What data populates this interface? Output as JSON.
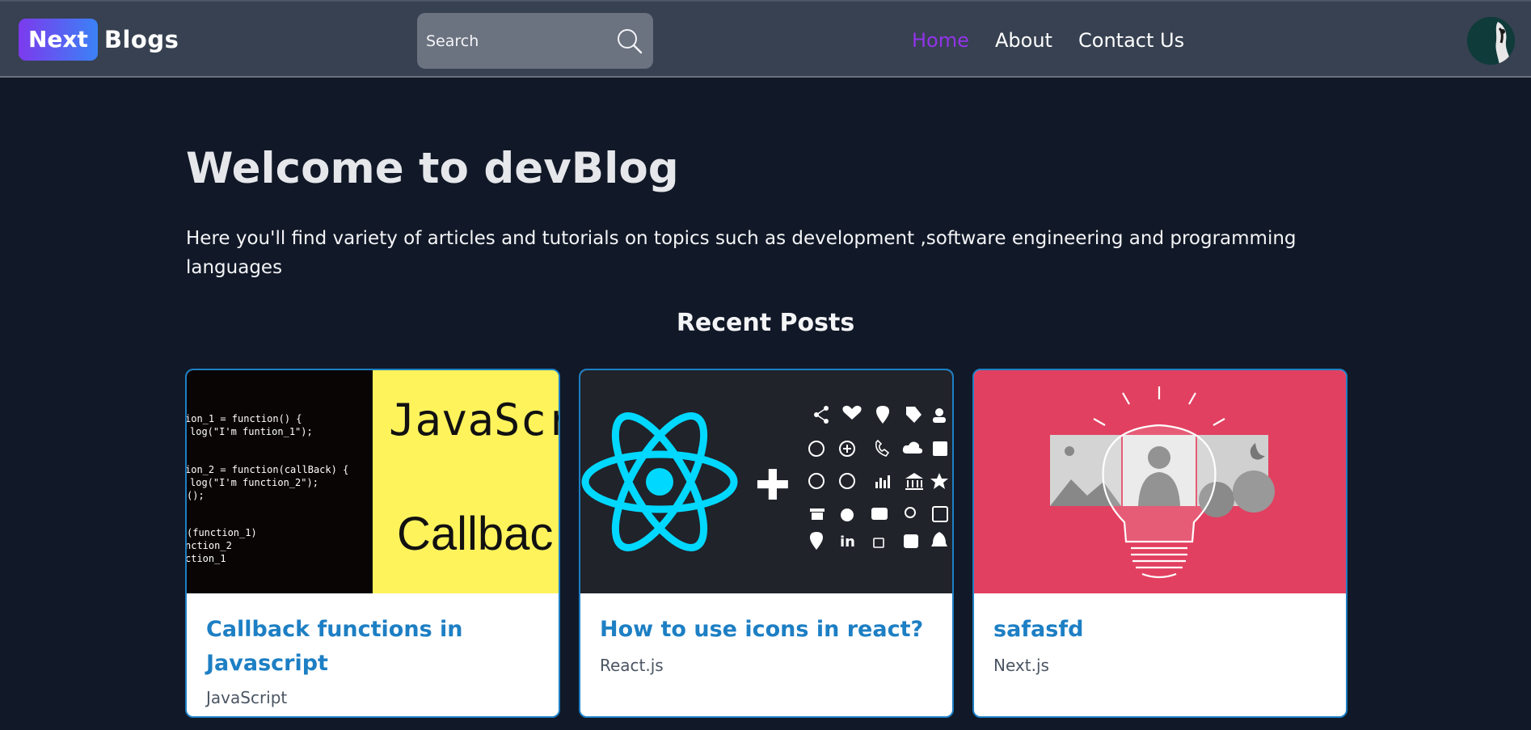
{
  "nav": {
    "logo_badge": "Next",
    "logo_text": "Blogs",
    "search_placeholder": "Search",
    "links": [
      {
        "label": "Home"
      },
      {
        "label": "About"
      },
      {
        "label": "Contact Us"
      }
    ],
    "active_color": "#9333ea"
  },
  "hero": {
    "title": "Welcome to devBlog",
    "description": "Here you'll find variety of articles and tutorials on topics such as development ,software engineering and programming languages"
  },
  "recent": {
    "heading": "Recent Posts",
    "posts": [
      {
        "title": "Callback functions in Javascript",
        "tag": "JavaScript",
        "image": {
          "big_text_1": "JavaScr",
          "big_text_2": "Callbac",
          "code_lines": [
            "ion_1 = function() {",
            "log(\"I'm funtion_1\");",
            "ion_2 = function(callBack) {",
            "log(\"I'm function_2\");",
            "();",
            "(function_1)",
            "nction_2",
            "ction_1"
          ]
        }
      },
      {
        "title": "How to use icons in react?",
        "tag": "React.js",
        "image": {
          "plus": "✚"
        }
      },
      {
        "title": "safasfd",
        "tag": "Next.js",
        "image": {}
      }
    ]
  },
  "colors": {
    "background": "#111827",
    "navbar": "#374151",
    "card_title": "#1d7fc4",
    "card_border": "#1d7fc4",
    "react_blue": "#00d8ff",
    "js_yellow": "#fff35c",
    "idea_red": "#e24060"
  }
}
